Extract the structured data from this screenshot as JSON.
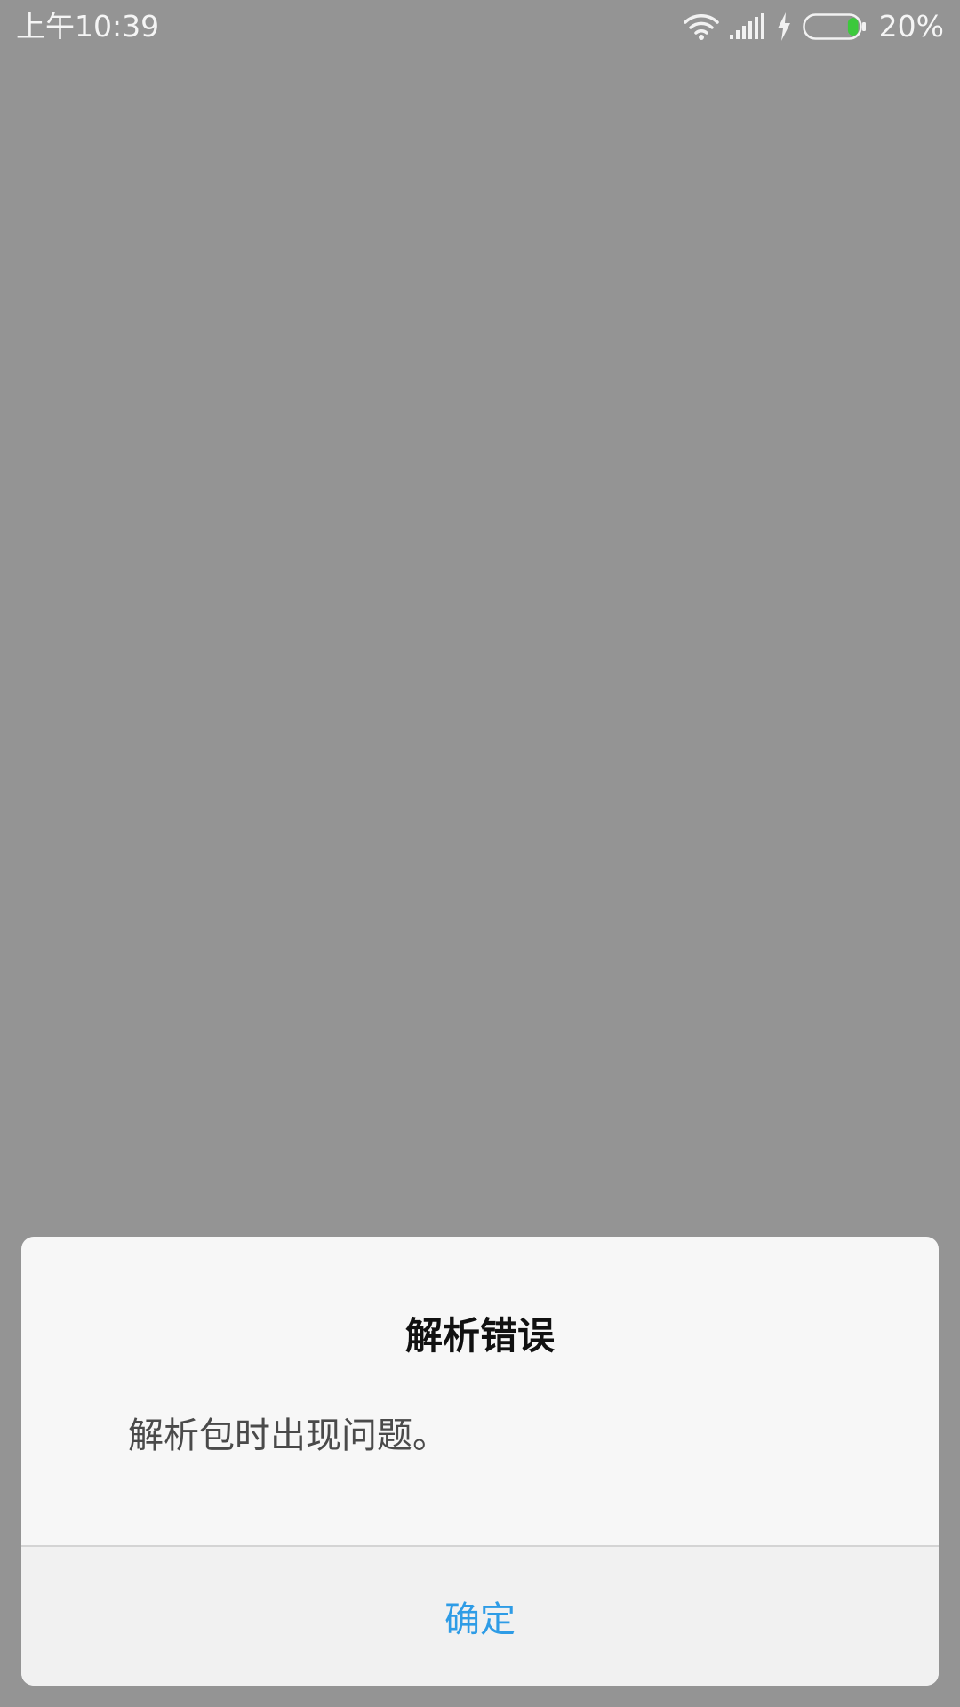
{
  "status_bar": {
    "time": "上午10:39",
    "battery_percent": "20%",
    "battery_level": 0.2,
    "icons": [
      "wifi-icon",
      "signal-icon",
      "charging-icon",
      "battery-icon"
    ],
    "battery_fill_color": "#3cc93c"
  },
  "dialog": {
    "title": "解析错误",
    "message": "解析包时出现问题。",
    "confirm_label": "确定",
    "accent_color": "#2e9ce6"
  }
}
